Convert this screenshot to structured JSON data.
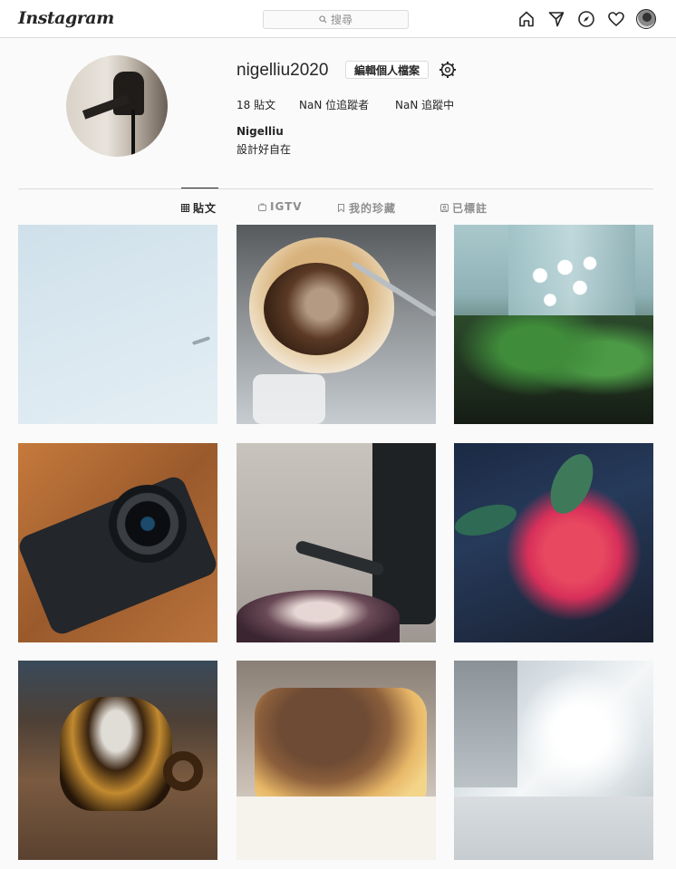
{
  "header": {
    "logo": "Instagram",
    "search": {
      "placeholder": "搜尋"
    },
    "nav_icons": [
      "home-icon",
      "direct-icon",
      "explore-icon",
      "activity-heart-icon",
      "profile-avatar"
    ]
  },
  "profile": {
    "username": "nigelliu2020",
    "edit_label": "編輯個人檔案",
    "stats": {
      "posts": "18 貼文",
      "followers": "NaN 位追蹤者",
      "following": "NaN 追蹤中"
    },
    "full_name": "Nigelliu",
    "bio": "設計好自在"
  },
  "tabs": [
    {
      "label": "貼文",
      "icon": "grid-icon",
      "active": true
    },
    {
      "label": "IGTV",
      "icon": "igtv-icon",
      "active": false
    },
    {
      "label": "我的珍藏",
      "icon": "bookmark-icon",
      "active": false
    },
    {
      "label": "已標註",
      "icon": "tagged-icon",
      "active": false
    }
  ],
  "posts": [
    "sky-with-bird",
    "pour-over-coffee",
    "white-flowers",
    "gxr-camera",
    "kettle-pour",
    "red-flower",
    "amber-glass-cup",
    "basque-cheesecake",
    "sunlit-street"
  ],
  "colors": {
    "background": "#fafafa",
    "border": "#dbdbdb",
    "text": "#262626",
    "muted": "#8e8e8e"
  }
}
